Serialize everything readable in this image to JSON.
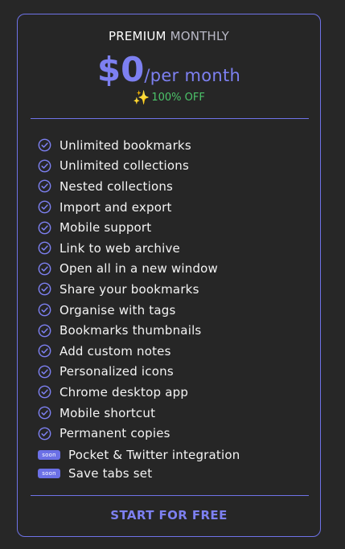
{
  "plan": {
    "name_strong": "PREMIUM",
    "name_muted": "MONTHLY",
    "price": "$0",
    "period": "/per month",
    "discount_icon": "sparkles-icon",
    "discount_text": "100% OFF"
  },
  "features": [
    "Unlimited bookmarks",
    "Unlimited collections",
    "Nested collections",
    "Import and export",
    "Mobile support",
    "Link to web archive",
    "Open all in a new window",
    "Share your bookmarks",
    "Organise with tags",
    "Bookmarks thumbnails",
    "Add custom notes",
    "Personalized icons",
    "Chrome desktop app",
    "Mobile shortcut",
    "Permanent copies"
  ],
  "coming_soon": {
    "badge": "soon",
    "items": [
      "Pocket & Twitter integration",
      "Save tabs set"
    ]
  },
  "cta": {
    "label": "START FOR FREE"
  },
  "colors": {
    "accent": "#7d80f1",
    "border": "#6f73e8",
    "background": "#272727",
    "discount": "#4cc46a"
  }
}
